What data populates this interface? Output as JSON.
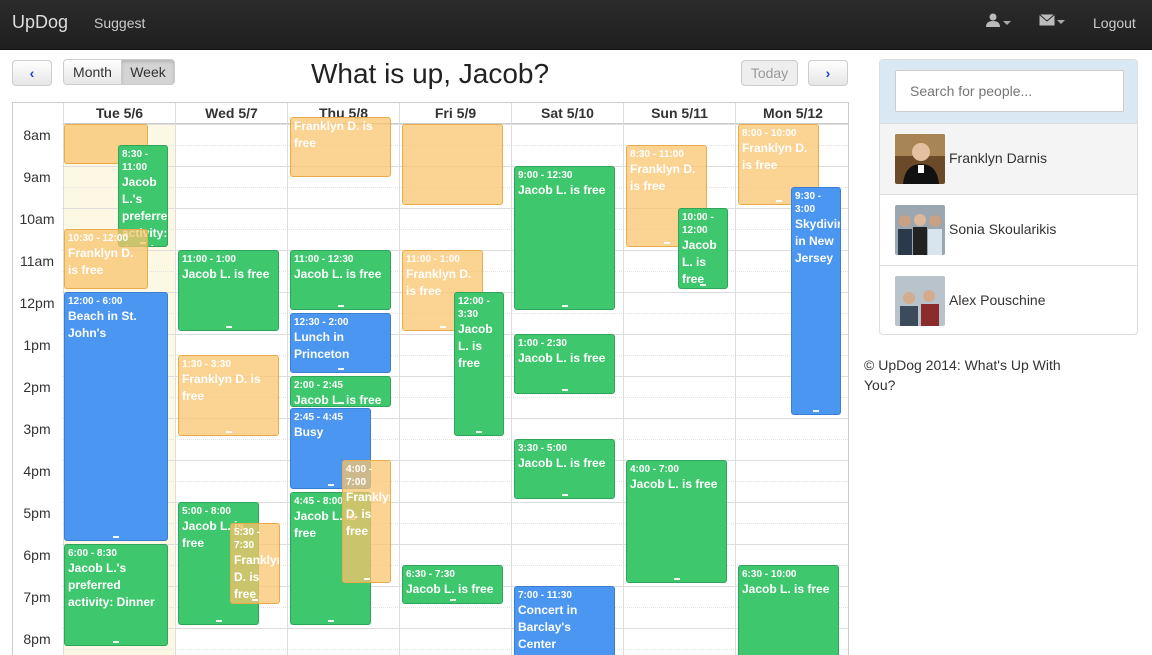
{
  "navbar": {
    "brand": "UpDog",
    "suggest": "Suggest",
    "logout": "Logout"
  },
  "controls": {
    "prev": "‹",
    "next": "›",
    "month": "Month",
    "week": "Week",
    "today": "Today"
  },
  "greeting": "What is up, Jacob?",
  "calendar": {
    "days": [
      "Tue 5/6",
      "Wed 5/7",
      "Thu 5/8",
      "Fri 5/9",
      "Sat 5/10",
      "Sun 5/11",
      "Mon 5/12"
    ],
    "hours": [
      "8am",
      "9am",
      "10am",
      "11am",
      "12pm",
      "1pm",
      "2pm",
      "3pm",
      "4pm",
      "5pm",
      "6pm",
      "7pm",
      "8pm"
    ],
    "events": [
      {
        "time": "",
        "title": "",
        "color": "orange"
      },
      {
        "time": "8:30 - 11:00",
        "title": "Jacob L.'s preferred activity: Jogging",
        "color": "green"
      },
      {
        "time": "10:30 - 12:00",
        "title": "Franklyn D. is free",
        "color": "orange"
      },
      {
        "time": "12:00 - 6:00",
        "title": "Beach in St. John's",
        "color": "blue"
      },
      {
        "time": "6:00 - 8:30",
        "title": "Jacob L.'s preferred activity: Dinner",
        "color": "green"
      },
      {
        "time": "11:00 - 1:00",
        "title": "Jacob L. is free",
        "color": "green"
      },
      {
        "time": "1:30 - 3:30",
        "title": "Franklyn D. is free",
        "color": "orange"
      },
      {
        "time": "5:00 - 8:00",
        "title": "Jacob L. is free",
        "color": "green"
      },
      {
        "time": "5:30 - 7:30",
        "title": "Franklyn D. is free",
        "color": "orange"
      },
      {
        "time": "",
        "title": "Franklyn D. is free",
        "color": "orange"
      },
      {
        "time": "11:00 - 12:30",
        "title": "Jacob L. is free",
        "color": "green"
      },
      {
        "time": "12:30 - 2:00",
        "title": "Lunch in Princeton",
        "color": "blue"
      },
      {
        "time": "2:00 - 2:45",
        "title": "Jacob L. is free",
        "color": "green"
      },
      {
        "time": "2:45 - 4:45",
        "title": "Busy",
        "color": "blue"
      },
      {
        "time": "4:45 - 8:00",
        "title": "Jacob L. is free",
        "color": "green"
      },
      {
        "time": "4:00 - 7:00",
        "title": "Franklyn D. is free",
        "color": "orange"
      },
      {
        "time": "",
        "title": "",
        "color": "orange"
      },
      {
        "time": "11:00 - 1:00",
        "title": "Franklyn D. is free",
        "color": "orange"
      },
      {
        "time": "12:00 - 3:30",
        "title": "Jacob L. is free",
        "color": "green"
      },
      {
        "time": "6:30 - 7:30",
        "title": "Jacob L. is free",
        "color": "green"
      },
      {
        "time": "9:00 - 12:30",
        "title": "Jacob L. is free",
        "color": "green"
      },
      {
        "time": "1:00 - 2:30",
        "title": "Jacob L. is free",
        "color": "green"
      },
      {
        "time": "3:30 - 5:00",
        "title": "Jacob L. is free",
        "color": "green"
      },
      {
        "time": "7:00 - 11:30",
        "title": "Concert in Barclay's Center",
        "color": "blue"
      },
      {
        "time": "8:30 - 11:00",
        "title": "Franklyn D. is free",
        "color": "orange"
      },
      {
        "time": "10:00 - 12:00",
        "title": "Jacob L. is free",
        "color": "green"
      },
      {
        "time": "4:00 - 7:00",
        "title": "Jacob L. is free",
        "color": "green"
      },
      {
        "time": "8:00 - 10:00",
        "title": "Franklyn D. is free",
        "color": "orange"
      },
      {
        "time": "9:30 - 3:00",
        "title": "Skydiving in New Jersey",
        "color": "blue"
      },
      {
        "time": "6:30 - 10:00",
        "title": "Jacob L. is free",
        "color": "green"
      }
    ]
  },
  "sidebar": {
    "search_placeholder": "Search for people...",
    "people": [
      "Franklyn Darnis",
      "Sonia Skoularikis",
      "Alex Pouschine"
    ]
  },
  "footer": "© UpDog 2014: What's Up With You?"
}
